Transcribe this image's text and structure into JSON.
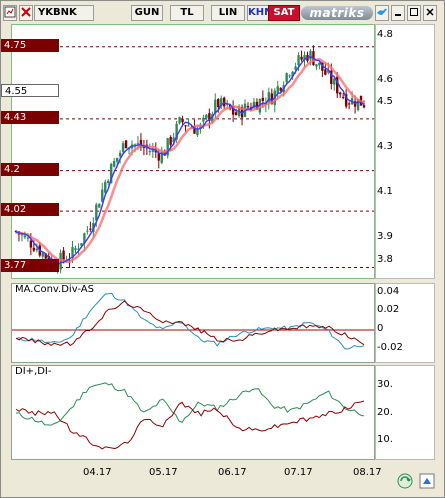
{
  "toolbar": {
    "symbol": "YKBNK",
    "buttons": [
      "GUN",
      "TL",
      "LIN",
      "KHM"
    ],
    "sat": "SAT",
    "logo": "matriks"
  },
  "price_panel": {
    "levels": [
      "4.75",
      "4.43",
      "4.2",
      "4.02",
      "3.77"
    ],
    "current": "4.55",
    "ticks": [
      "4.8",
      "4.6",
      "4.5",
      "4.3",
      "4.1",
      "3.9",
      "3.8"
    ]
  },
  "macd_panel": {
    "title": "MA.Conv.Div-AS",
    "ticks": [
      "0.04",
      "0.02",
      "0",
      "-0.02"
    ]
  },
  "di_panel": {
    "title": "DI+,DI-",
    "ticks": [
      "30.",
      "20.",
      "10."
    ]
  },
  "dates": [
    "04.17",
    "05.17",
    "06.17",
    "07.17",
    "08.17"
  ],
  "colors": {
    "up": "#2E8B57",
    "down": "#7B0000",
    "ma_fast": "#3A3AFF",
    "ma_slow": "#FF6E6E",
    "level_tag": "#7B0000"
  },
  "chart_data": [
    {
      "type": "candlestick",
      "title": "",
      "ylim": [
        3.75,
        4.82
      ],
      "x": [
        "04.17",
        "05.17",
        "06.17",
        "07.17",
        "08.17"
      ],
      "close_trend": [
        3.93,
        3.87,
        3.79,
        3.82,
        3.95,
        4.18,
        4.33,
        4.3,
        4.27,
        4.42,
        4.38,
        4.5,
        4.45,
        4.5,
        4.53,
        4.66,
        4.72,
        4.62,
        4.52,
        4.5
      ],
      "horizontal_levels": [
        4.75,
        4.43,
        4.2,
        4.02,
        3.77
      ],
      "current_price": 4.55
    },
    {
      "type": "line",
      "title": "MA.Conv.Div-AS",
      "ylim": [
        -0.03,
        0.045
      ],
      "series": [
        {
          "values": [
            -0.01,
            -0.01,
            -0.015,
            -0.008,
            0.02,
            0.04,
            0.03,
            0.01,
            0.0,
            0.01,
            -0.01,
            -0.015,
            -0.005,
            0.0,
            0.002,
            0.002,
            0.008,
            0.0,
            -0.02,
            -0.015
          ]
        },
        {
          "values": [
            -0.008,
            -0.012,
            -0.015,
            -0.015,
            0.0,
            0.02,
            0.03,
            0.02,
            0.01,
            0.008,
            0.0,
            -0.01,
            -0.012,
            -0.005,
            0.0,
            0.002,
            0.004,
            0.003,
            -0.005,
            -0.015
          ]
        }
      ]
    },
    {
      "type": "line",
      "title": "DI+,DI-",
      "ylim": [
        5,
        36
      ],
      "series": [
        {
          "values": [
            20,
            18,
            15,
            22,
            30,
            31,
            28,
            20,
            25,
            17,
            24,
            22,
            26,
            30,
            23,
            21,
            24,
            28,
            22,
            20
          ]
        },
        {
          "values": [
            22,
            20,
            21,
            14,
            10,
            7,
            9,
            18,
            16,
            24,
            20,
            22,
            15,
            14,
            15,
            17,
            18,
            20,
            22,
            25
          ]
        }
      ]
    }
  ]
}
